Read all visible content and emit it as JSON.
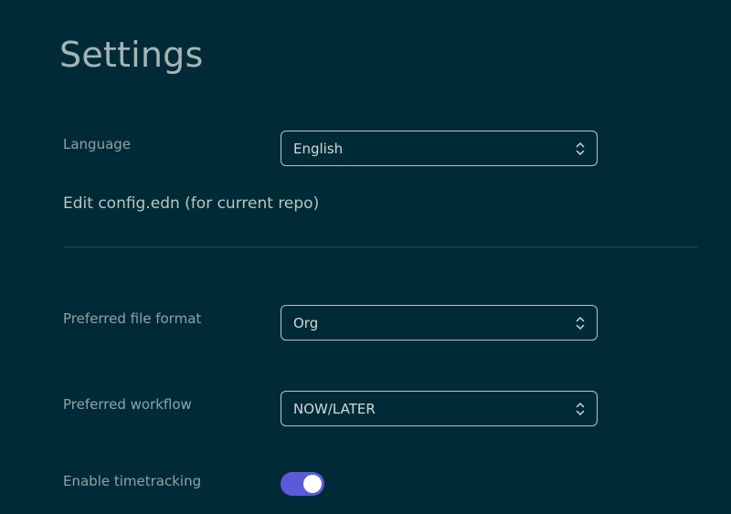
{
  "page": {
    "title": "Settings"
  },
  "language": {
    "label": "Language",
    "value": "English"
  },
  "edit_config": {
    "label": "Edit config.edn (for current repo)"
  },
  "file_format": {
    "label": "Preferred file format",
    "value": "Org"
  },
  "workflow": {
    "label": "Preferred workflow",
    "value": "NOW/LATER"
  },
  "timetracking": {
    "label": "Enable timetracking",
    "enabled": true
  },
  "colors": {
    "background": "#002b36",
    "toggle_on": "#5b5bd9",
    "divider": "#164b57"
  },
  "icons": {
    "select_indicator": "chevron-updown-icon"
  }
}
